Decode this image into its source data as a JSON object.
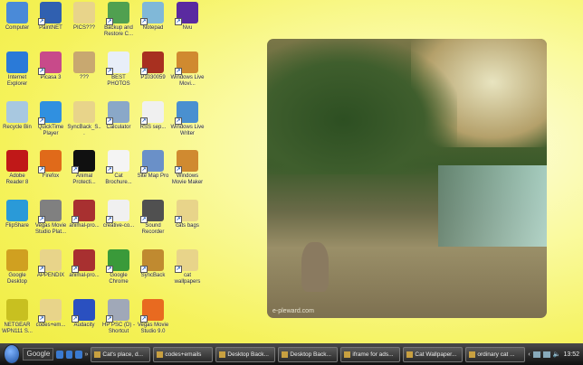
{
  "desktop": {
    "icons": [
      {
        "label": "Computer",
        "color": "#4a8ad8"
      },
      {
        "label": "PaintNET",
        "color": "#3060b0"
      },
      {
        "label": "PICS???",
        "color": "#e8d48a"
      },
      {
        "label": "Backup and Restore C...",
        "color": "#50a050"
      },
      {
        "label": "Notepad",
        "color": "#80b8d8"
      },
      {
        "label": "Nvu",
        "color": "#5a2aa0"
      },
      {
        "label": "Internet Explorer",
        "color": "#2a7ad8"
      },
      {
        "label": "Picasa 3",
        "color": "#c84a8a"
      },
      {
        "label": "???",
        "color": "#c8a870"
      },
      {
        "label": "BEST PHOTOS",
        "color": "#e8eef8"
      },
      {
        "label": "P1030059",
        "color": "#a83020"
      },
      {
        "label": "Windows Live Movi...",
        "color": "#d08a30"
      },
      {
        "label": "Recycle Bin",
        "color": "#a8c8e0"
      },
      {
        "label": "QuickTime Player",
        "color": "#3090e0"
      },
      {
        "label": "SyncBack_S...",
        "color": "#e8d48a"
      },
      {
        "label": "Calculator",
        "color": "#8aa8c8"
      },
      {
        "label": "RSS sep...",
        "color": "#f0f0f0"
      },
      {
        "label": "Windows Live Writer",
        "color": "#4a90d0"
      },
      {
        "label": "Adobe Reader 8",
        "color": "#c01818"
      },
      {
        "label": "Firefox",
        "color": "#e06a1a"
      },
      {
        "label": "Animal Protecti...",
        "color": "#101010"
      },
      {
        "label": "Cat Brochure...",
        "color": "#f4f4f4"
      },
      {
        "label": "Site Map Pro",
        "color": "#6a90c8"
      },
      {
        "label": "Windows Movie Maker",
        "color": "#d08a30"
      },
      {
        "label": "FlipShare",
        "color": "#2a9ad8"
      },
      {
        "label": "Vegas Movie Studio Plat...",
        "color": "#808080"
      },
      {
        "label": "animal-pro...",
        "color": "#a83030"
      },
      {
        "label": "creative-co...",
        "color": "#f0f0f0"
      },
      {
        "label": "Sound Recorder",
        "color": "#505050"
      },
      {
        "label": "cats bags",
        "color": "#e8d48a"
      },
      {
        "label": "Google Desktop",
        "color": "#d0a020"
      },
      {
        "label": "APPENDIX",
        "color": "#e8d48a"
      },
      {
        "label": "animal-pro...",
        "color": "#a83030"
      },
      {
        "label": "Google Chrome",
        "color": "#3a9a3a"
      },
      {
        "label": "SyncBack",
        "color": "#c08a30"
      },
      {
        "label": "cat wallpapers",
        "color": "#e8d48a"
      },
      {
        "label": "NETGEAR WPN111 S...",
        "color": "#c8c020"
      },
      {
        "label": "codes+em...",
        "color": "#e8d48a"
      },
      {
        "label": "Audacity",
        "color": "#2a50c0"
      },
      {
        "label": "HP PSC (D) - Shortcut",
        "color": "#a0a8b8"
      },
      {
        "label": "Vegas Movie Studio 9.0",
        "color": "#e86a20"
      }
    ]
  },
  "wallpaper": {
    "watermark": "e-pleward.com"
  },
  "taskbar": {
    "search": "Google",
    "tasks": [
      {
        "label": "Cat's place, d..."
      },
      {
        "label": "codes+emails"
      },
      {
        "label": "Desktop Back..."
      },
      {
        "label": "Desktop Back..."
      },
      {
        "label": "iframe for ads..."
      },
      {
        "label": "Cat Wallpaper..."
      },
      {
        "label": "ordinary cat ..."
      }
    ],
    "clock": "13:52"
  }
}
